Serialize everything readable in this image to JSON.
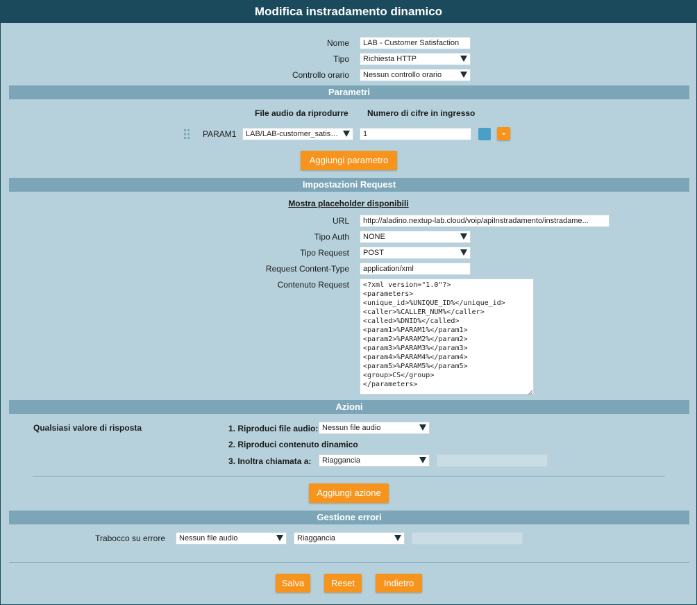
{
  "title": "Modifica instradamento dinamico",
  "form": {
    "nome_label": "Nome",
    "nome_value": "LAB - Customer Satisfaction",
    "tipo_label": "Tipo",
    "tipo_value": "Richiesta HTTP",
    "controllo_label": "Controllo orario",
    "controllo_value": "Nessun controllo orario"
  },
  "parametri": {
    "section_title": "Parametri",
    "col_file": "File audio da riprodurre",
    "col_cifre": "Numero di cifre in ingresso",
    "rows": [
      {
        "name": "PARAM1",
        "file": "LAB/LAB-customer_satisfaction",
        "digits": "1"
      }
    ],
    "remove_label": "-",
    "add_button": "Aggiungi parametro"
  },
  "request": {
    "section_title": "Impostazioni Request",
    "placeholder_link": "Mostra placeholder disponibili",
    "url_label": "URL",
    "url_value": "http://aladino.nextup-lab.cloud/voip/apiInstradamento/instradame...",
    "auth_label": "Tipo Auth",
    "auth_value": "NONE",
    "type_label": "Tipo Request",
    "type_value": "POST",
    "content_type_label": "Request Content-Type",
    "content_type_value": "application/xml",
    "body_label": "Contenuto Request",
    "body_value": "<?xml version=\"1.0\"?>\n<parameters>\n<unique_id>%UNIQUE_ID%</unique_id>\n<caller>%CALLER_NUM%</caller>\n<called>%DNID%</called>\n<param1>%PARAM1%</param1>\n<param2>%PARAM2%</param2>\n<param3>%PARAM3%</param3>\n<param4>%PARAM4%</param4>\n<param5>%PARAM5%</param5>\n<group>CS</group>\n</parameters>"
  },
  "azioni": {
    "section_title": "Azioni",
    "response_label": "Qualsiasi valore di risposta",
    "step1_label": "1. Riproduci file audio:",
    "step1_value": "Nessun file audio",
    "step2_label": "2. Riproduci contenuto dinamico",
    "step3_label": "3. Inoltra chiamata a:",
    "step3_value": "Riaggancia",
    "add_button": "Aggiungi azione"
  },
  "errori": {
    "section_title": "Gestione errori",
    "overflow_label": "Trabocco su errore",
    "audio_value": "Nessun file audio",
    "action_value": "Riaggancia"
  },
  "footer": {
    "save": "Salva",
    "reset": "Reset",
    "back": "Indietro"
  },
  "colors": {
    "header": "#1b4a5c",
    "background": "#b6d1db",
    "section": "#7ca6b8",
    "accent": "#f7941d",
    "square_button": "#4a9fc9"
  }
}
